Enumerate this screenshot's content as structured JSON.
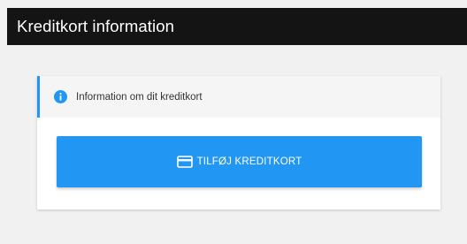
{
  "header": {
    "title": "Kreditkort information"
  },
  "info": {
    "text": "Information om dit kreditkort",
    "icon": "info-icon",
    "accent_color": "#2196f3"
  },
  "actions": {
    "add_card_label": "TILFØJ KREDITKORT",
    "add_card_icon": "credit-card-icon",
    "button_color": "#2196f3"
  }
}
